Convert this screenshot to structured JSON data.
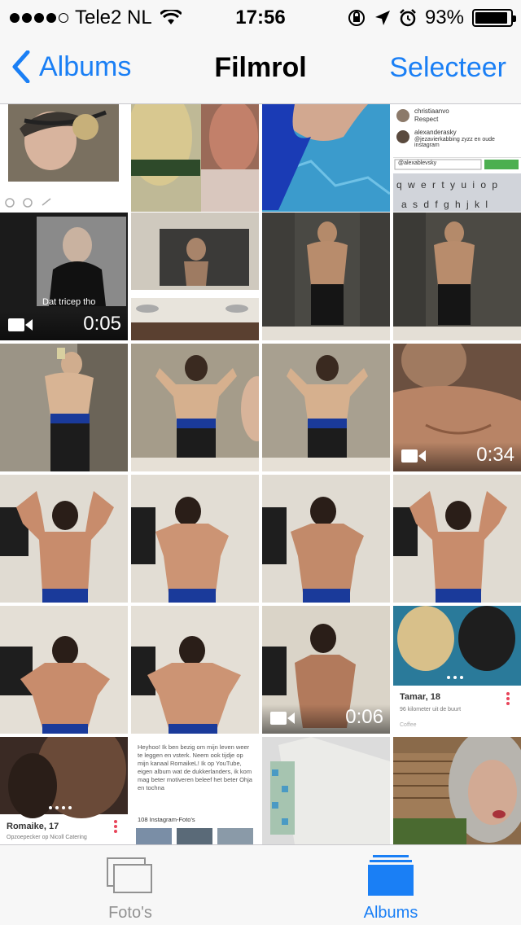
{
  "status": {
    "carrier": "Tele2 NL",
    "time": "17:56",
    "battery": "93%",
    "battery_level": 0.93
  },
  "nav": {
    "back_label": "Albums",
    "title": "Filmrol",
    "select_label": "Selecteer"
  },
  "grid": {
    "videos": [
      {
        "duration": "0:05"
      },
      {
        "duration": "0:34"
      },
      {
        "duration": "0:06"
      }
    ],
    "captions": {
      "tricep": "Dat tricep tho",
      "dm_user1": "christiaanvo",
      "dm_text1": "Respect",
      "dm_user2": "alexanderasky",
      "dm_text2": "@jezavierkabbing zyzz en oude instagram",
      "dm_input": "@alexablevsky",
      "profile1_name": "Tamar, 18",
      "profile1_dist": "96 kilometer uit de buurt",
      "profile2_name": "Romaike, 17",
      "profile2_sub": "Opzoepecker op Nicoll Catering",
      "bio_text": "Heyhoo! Ik ben bezig om mijn leven weer te leggen en vsterk. Neem ook tijdje op mijn kanaal RomaikeL! Ik op YouTube, eigen album wat de dukkerlanders, ik kom mag beter motiveren beleef het beter Ohja en tochna",
      "insta_count": "108 Instagram-Foto's",
      "tinder_brand": "Coffee",
      "keyboard_row1": "q w e r t y u i o p",
      "keyboard_row2": "a s d f g h j k l"
    }
  },
  "tabs": [
    {
      "label": "Foto's"
    },
    {
      "label": "Albums"
    }
  ],
  "colors": {
    "accent": "#1a7ff5",
    "inactive": "#929292"
  }
}
